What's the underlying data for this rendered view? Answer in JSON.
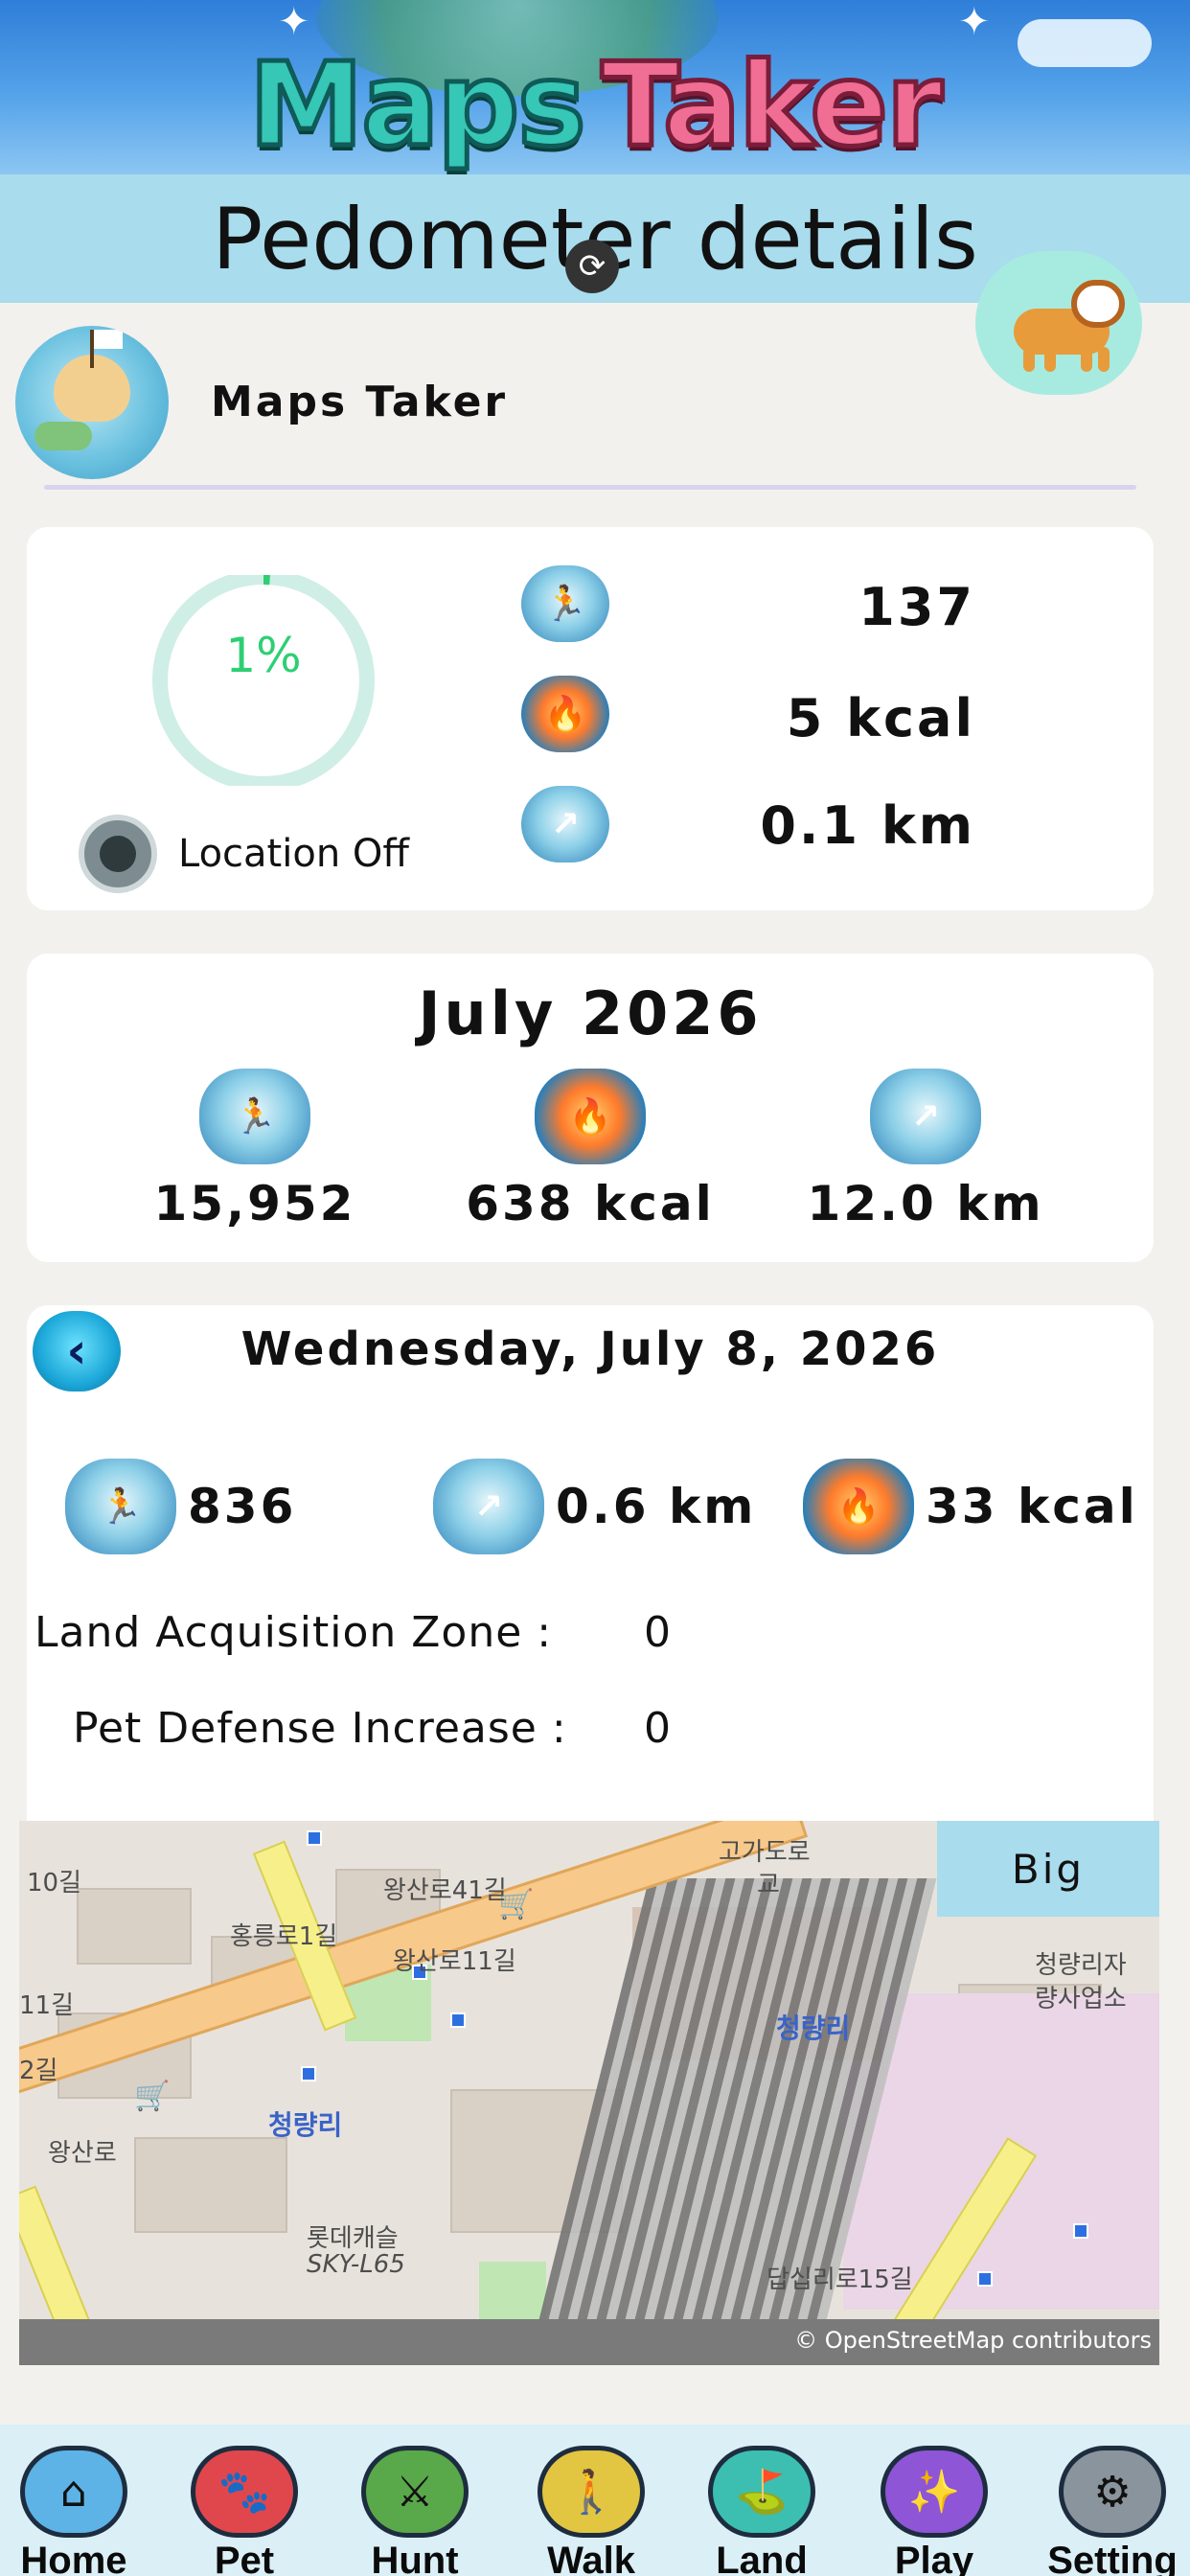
{
  "banner": {
    "word1": "Maps",
    "word2": "Taker"
  },
  "page_title": "Pedometer details",
  "profile": {
    "name": "Maps Taker"
  },
  "today": {
    "progress_percent": 1,
    "progress_label": "1%",
    "location_status": "Location Off",
    "steps": "137",
    "calories": "5 kcal",
    "distance": "0.1 km"
  },
  "month": {
    "title": "July 2026",
    "steps": "15,952",
    "calories": "638 kcal",
    "distance": "12.0 km"
  },
  "day": {
    "date": "Wednesday, July 8, 2026",
    "steps": "836",
    "distance": "0.6 km",
    "calories": "33 kcal",
    "land_zone_label": "Land Acquisition Zone :",
    "land_zone_value": "0",
    "pet_defense_label": "Pet Defense Increase :",
    "pet_defense_value": "0"
  },
  "map": {
    "big_button": "Big",
    "attribution": "© OpenStreetMap contributors",
    "labels": [
      "10길",
      "왕산로41길",
      "홍릉로1길",
      "고가도로",
      "교",
      "청량리자",
      "량사업소",
      "11길",
      "2길",
      "왕산로",
      "청량리",
      "롯데캐슬",
      "SKY-L65",
      "답십리로15길",
      "왕산로11길",
      "청량리"
    ]
  },
  "bottom_nav": {
    "items": [
      {
        "label": "Home",
        "icon": "home-icon"
      },
      {
        "label": "Pet",
        "icon": "pet-icon"
      },
      {
        "label": "Hunt",
        "icon": "hunt-icon"
      },
      {
        "label": "Walk",
        "icon": "walk-icon"
      },
      {
        "label": "Land",
        "icon": "land-icon"
      },
      {
        "label": "Play",
        "icon": "play-icon"
      },
      {
        "label": "Setting",
        "icon": "setting-icon"
      }
    ]
  },
  "colors": {
    "header_bg": "#a9dced",
    "progress_green": "#2ecf74",
    "ring_track": "#cfeee6",
    "nav_bg": "#dbeff6"
  }
}
